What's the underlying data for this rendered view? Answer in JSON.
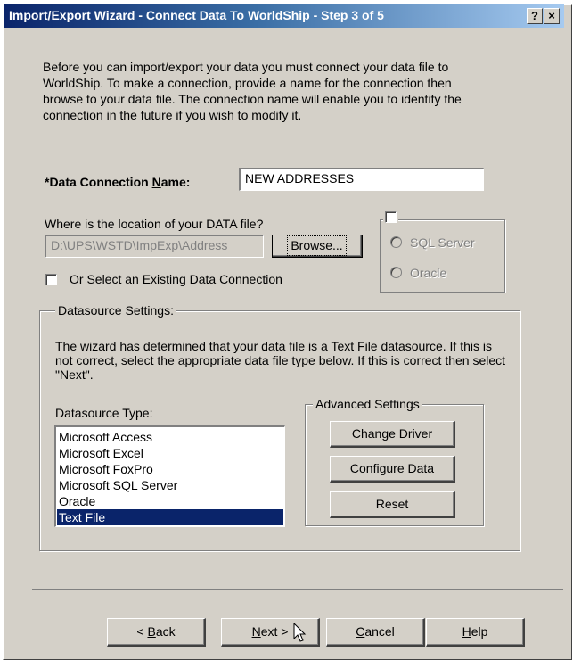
{
  "window": {
    "title": "Import/Export Wizard - Connect Data To WorldShip - Step 3 of 5",
    "help_glyph": "?",
    "close_glyph": "×"
  },
  "intro_text": "Before you can import/export your data you must connect your data file to WorldShip. To make a connection, provide a name for the connection then browse to your data file. The connection name will enable you to identify the connection in the future if you wish to modify it.",
  "connection": {
    "label_prefix": "*Data Connection ",
    "label_underlined": "N",
    "label_suffix": "ame:",
    "value": "NEW ADDRESSES"
  },
  "location": {
    "question": "Where is the location of your DATA file?",
    "path": "D:\\UPS\\WSTD\\ImpExp\\Address",
    "browse_label": "Browse..."
  },
  "existing_checkbox_label": "Or Select an Existing Data Connection",
  "server_options": {
    "sql_server": "SQL Server",
    "oracle": "Oracle"
  },
  "datasource_settings": {
    "title": "Datasource Settings:",
    "description": "The wizard has determined that your data file is a Text File datasource. If this is not correct, select the appropriate data file type below. If this is correct then select \"Next\".",
    "type_label": "Datasource Type:",
    "types": [
      "Microsoft Access",
      "Microsoft Excel",
      "Microsoft FoxPro",
      "Microsoft SQL Server",
      "Oracle",
      "Text File"
    ],
    "selected_type": "Text File"
  },
  "advanced_settings": {
    "title": "Advanced Settings",
    "change_driver": "Change Driver",
    "configure_data": "Configure Data",
    "reset": "Reset"
  },
  "footer": {
    "back_prefix": "< ",
    "back_underlined": "B",
    "back_suffix": "ack",
    "next_underlined": "N",
    "next_suffix": "ext >",
    "cancel_underlined": "C",
    "cancel_suffix": "ancel",
    "help_underlined": "H",
    "help_suffix": "elp"
  }
}
